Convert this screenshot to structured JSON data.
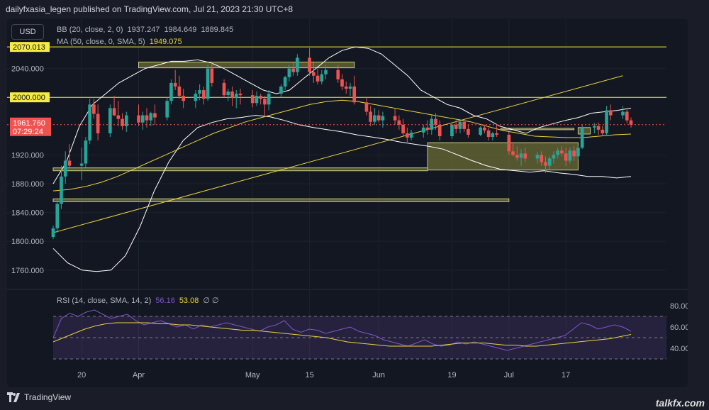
{
  "header": {
    "text": "dailyfxasia_legen published on TradingView.com, Jul 21, 2023 21:30 UTC+8"
  },
  "currency": "USD",
  "legend": {
    "bb": {
      "label": "BB (20, close, 2, 0)",
      "basis": "1937.247",
      "upper": "1984.649",
      "lower": "1889.845"
    },
    "ma": {
      "label": "MA (50, close, 0, SMA, 5)",
      "value": "1949.075"
    },
    "rsi": {
      "label": "RSI (14, close, SMA, 14, 2)",
      "value": "56.16",
      "sma": "53.08",
      "extra": "∅ ∅"
    }
  },
  "price_tag": {
    "price": "1961.760",
    "countdown": "07:29:24"
  },
  "footer": {
    "brand": "TradingView"
  },
  "watermark": "talkfx.com",
  "colors": {
    "up": "#26a69a",
    "down": "#ef5350",
    "bb": "#ffffff",
    "ma": "#e6d343",
    "rsi": "#7e57c2",
    "rsi_ma": "#e6d343",
    "level": "#f5eb42"
  },
  "chart_data": {
    "type": "candlestick",
    "instrument": "XAUUSD",
    "price_axis": {
      "ticks": [
        1760,
        1800,
        1840,
        1880,
        1920,
        2040
      ],
      "min": 1745,
      "max": 2080
    },
    "x_ticks": [
      "20",
      "Apr",
      "May",
      "15",
      "Jun",
      "19",
      "Jul",
      "17"
    ],
    "x_tick_dates": [
      "2023-03-20",
      "2023-04-03",
      "2023-05-01",
      "2023-05-15",
      "2023-06-01",
      "2023-06-19",
      "2023-07-03",
      "2023-07-17"
    ],
    "horizontal_levels": [
      {
        "price": 2070.013,
        "label": "2070.013"
      },
      {
        "price": 2000.0,
        "label": "2000.000"
      }
    ],
    "zones": [
      {
        "start": "2023-04-03",
        "end": "2023-05-26",
        "low": 2041,
        "high": 2049
      },
      {
        "start": "2023-03-13",
        "end": "2023-06-13",
        "low": 1898,
        "high": 1902
      },
      {
        "start": "2023-03-13",
        "end": "2023-07-03",
        "low": 1855,
        "high": 1859
      },
      {
        "start": "2023-06-13",
        "end": "2023-07-20",
        "low": 1899,
        "high": 1937
      },
      {
        "start": "2023-07-20",
        "end": "2023-07-23",
        "low": 1949,
        "high": 1958
      },
      {
        "start": "2023-07-01",
        "end": "2023-07-19",
        "low": 1955,
        "high": 1957
      }
    ],
    "trendline": {
      "start": {
        "date": "2023-03-13",
        "price": 1812
      },
      "end": {
        "date": "2023-07-24",
        "price": 2030
      }
    },
    "candles": [
      {
        "date": "2023-03-13",
        "o": 1806,
        "h": 1822,
        "l": 1803,
        "c": 1818
      },
      {
        "date": "2023-03-14",
        "o": 1818,
        "h": 1860,
        "l": 1812,
        "c": 1852
      },
      {
        "date": "2023-03-15",
        "o": 1852,
        "h": 1905,
        "l": 1845,
        "c": 1890
      },
      {
        "date": "2023-03-16",
        "o": 1890,
        "h": 1925,
        "l": 1880,
        "c": 1912
      },
      {
        "date": "2023-03-17",
        "o": 1912,
        "h": 1935,
        "l": 1902,
        "c": 1905
      },
      {
        "date": "2023-03-20",
        "o": 1905,
        "h": 1930,
        "l": 1885,
        "c": 1908
      },
      {
        "date": "2023-03-21",
        "o": 1908,
        "h": 1945,
        "l": 1902,
        "c": 1940
      },
      {
        "date": "2023-03-22",
        "o": 1940,
        "h": 1998,
        "l": 1935,
        "c": 1990
      },
      {
        "date": "2023-03-23",
        "o": 1990,
        "h": 1998,
        "l": 1970,
        "c": 1977
      },
      {
        "date": "2023-03-24",
        "o": 1977,
        "h": 1990,
        "l": 1940,
        "c": 1950
      },
      {
        "date": "2023-03-27",
        "o": 1950,
        "h": 1990,
        "l": 1945,
        "c": 1985
      },
      {
        "date": "2023-03-28",
        "o": 1985,
        "h": 2002,
        "l": 1974,
        "c": 1975
      },
      {
        "date": "2023-03-29",
        "o": 1975,
        "h": 1995,
        "l": 1960,
        "c": 1970
      },
      {
        "date": "2023-03-30",
        "o": 1970,
        "h": 1978,
        "l": 1955,
        "c": 1960
      },
      {
        "date": "2023-03-31",
        "o": 1960,
        "h": 1980,
        "l": 1952,
        "c": 1975
      },
      {
        "date": "2023-04-03",
        "o": 1975,
        "h": 1990,
        "l": 1960,
        "c": 1965
      },
      {
        "date": "2023-04-04",
        "o": 1965,
        "h": 1980,
        "l": 1955,
        "c": 1975
      },
      {
        "date": "2023-04-05",
        "o": 1975,
        "h": 1985,
        "l": 1958,
        "c": 1968
      },
      {
        "date": "2023-04-06",
        "o": 1968,
        "h": 1980,
        "l": 1960,
        "c": 1978
      },
      {
        "date": "2023-04-07",
        "o": 1978,
        "h": 1990,
        "l": 1962,
        "c": 1972
      },
      {
        "date": "2023-04-10",
        "o": 1972,
        "h": 2000,
        "l": 1968,
        "c": 1995
      },
      {
        "date": "2023-04-11",
        "o": 1995,
        "h": 2025,
        "l": 1990,
        "c": 2020
      },
      {
        "date": "2023-04-12",
        "o": 2020,
        "h": 2038,
        "l": 2010,
        "c": 2015
      },
      {
        "date": "2023-04-13",
        "o": 2015,
        "h": 2030,
        "l": 1998,
        "c": 2002
      },
      {
        "date": "2023-04-14",
        "o": 2002,
        "h": 2012,
        "l": 1985,
        "c": 1995
      },
      {
        "date": "2023-04-17",
        "o": 1995,
        "h": 2010,
        "l": 1985,
        "c": 2005
      },
      {
        "date": "2023-04-18",
        "o": 2005,
        "h": 2018,
        "l": 1996,
        "c": 2010
      },
      {
        "date": "2023-04-19",
        "o": 2010,
        "h": 2015,
        "l": 1990,
        "c": 1998
      },
      {
        "date": "2023-04-20",
        "o": 1998,
        "h": 2045,
        "l": 1995,
        "c": 2040
      },
      {
        "date": "2023-04-21",
        "o": 2040,
        "h": 2048,
        "l": 2015,
        "c": 2020
      },
      {
        "date": "2023-04-24",
        "o": 2020,
        "h": 2025,
        "l": 2000,
        "c": 2003
      },
      {
        "date": "2023-04-25",
        "o": 2003,
        "h": 2012,
        "l": 1995,
        "c": 2008
      },
      {
        "date": "2023-04-26",
        "o": 2008,
        "h": 2015,
        "l": 1988,
        "c": 1999
      },
      {
        "date": "2023-04-27",
        "o": 1999,
        "h": 2010,
        "l": 1985,
        "c": 2005
      },
      {
        "date": "2023-04-28",
        "o": 2005,
        "h": 2012,
        "l": 1990,
        "c": 2003
      },
      {
        "date": "2023-05-01",
        "o": 2003,
        "h": 2010,
        "l": 1986,
        "c": 1992
      },
      {
        "date": "2023-05-02",
        "o": 1992,
        "h": 2008,
        "l": 1988,
        "c": 2002
      },
      {
        "date": "2023-05-03",
        "o": 2002,
        "h": 2005,
        "l": 1990,
        "c": 1998
      },
      {
        "date": "2023-05-04",
        "o": 1998,
        "h": 2002,
        "l": 1975,
        "c": 1990
      },
      {
        "date": "2023-05-05",
        "o": 1990,
        "h": 2010,
        "l": 1982,
        "c": 2005
      },
      {
        "date": "2023-05-08",
        "o": 2005,
        "h": 2018,
        "l": 2000,
        "c": 2015
      },
      {
        "date": "2023-05-09",
        "o": 2015,
        "h": 2030,
        "l": 2010,
        "c": 2028
      },
      {
        "date": "2023-05-10",
        "o": 2028,
        "h": 2045,
        "l": 2022,
        "c": 2040
      },
      {
        "date": "2023-05-11",
        "o": 2040,
        "h": 2048,
        "l": 2030,
        "c": 2035
      },
      {
        "date": "2023-05-12",
        "o": 2035,
        "h": 2060,
        "l": 2030,
        "c": 2055
      },
      {
        "date": "2023-05-15",
        "o": 2055,
        "h": 2068,
        "l": 2030,
        "c": 2035
      },
      {
        "date": "2023-05-16",
        "o": 2035,
        "h": 2050,
        "l": 2020,
        "c": 2030
      },
      {
        "date": "2023-05-17",
        "o": 2030,
        "h": 2040,
        "l": 2018,
        "c": 2022
      },
      {
        "date": "2023-05-18",
        "o": 2022,
        "h": 2038,
        "l": 2018,
        "c": 2032
      },
      {
        "date": "2023-05-19",
        "o": 2032,
        "h": 2045,
        "l": 2025,
        "c": 2038
      },
      {
        "date": "2023-05-22",
        "o": 2038,
        "h": 2045,
        "l": 2020,
        "c": 2025
      },
      {
        "date": "2023-05-23",
        "o": 2025,
        "h": 2032,
        "l": 2010,
        "c": 2015
      },
      {
        "date": "2023-05-24",
        "o": 2015,
        "h": 2022,
        "l": 2005,
        "c": 2012
      },
      {
        "date": "2023-05-25",
        "o": 2012,
        "h": 2020,
        "l": 2002,
        "c": 2015
      },
      {
        "date": "2023-05-26",
        "o": 2015,
        "h": 2030,
        "l": 1990,
        "c": 1993
      },
      {
        "date": "2023-05-29",
        "o": 1993,
        "h": 2000,
        "l": 1975,
        "c": 1980
      },
      {
        "date": "2023-05-30",
        "o": 1980,
        "h": 1988,
        "l": 1960,
        "c": 1966
      },
      {
        "date": "2023-05-31",
        "o": 1966,
        "h": 1985,
        "l": 1962,
        "c": 1975
      },
      {
        "date": "2023-06-01",
        "o": 1975,
        "h": 1982,
        "l": 1965,
        "c": 1968
      },
      {
        "date": "2023-06-02",
        "o": 1968,
        "h": 1980,
        "l": 1958,
        "c": 1974
      },
      {
        "date": "2023-06-05",
        "o": 1974,
        "h": 1985,
        "l": 1962,
        "c": 1968
      },
      {
        "date": "2023-06-06",
        "o": 1968,
        "h": 1975,
        "l": 1955,
        "c": 1962
      },
      {
        "date": "2023-06-07",
        "o": 1962,
        "h": 1970,
        "l": 1945,
        "c": 1950
      },
      {
        "date": "2023-06-08",
        "o": 1950,
        "h": 1958,
        "l": 1938,
        "c": 1944
      },
      {
        "date": "2023-06-09",
        "o": 1944,
        "h": 1955,
        "l": 1940,
        "c": 1951
      },
      {
        "date": "2023-06-12",
        "o": 1951,
        "h": 1962,
        "l": 1944,
        "c": 1958
      },
      {
        "date": "2023-06-13",
        "o": 1958,
        "h": 1968,
        "l": 1948,
        "c": 1955
      },
      {
        "date": "2023-06-14",
        "o": 1955,
        "h": 1975,
        "l": 1948,
        "c": 1970
      },
      {
        "date": "2023-06-15",
        "o": 1970,
        "h": 1978,
        "l": 1955,
        "c": 1962
      },
      {
        "date": "2023-06-16",
        "o": 1962,
        "h": 1968,
        "l": 1940,
        "c": 1946
      },
      {
        "date": "2023-06-19",
        "o": 1946,
        "h": 1965,
        "l": 1942,
        "c": 1962
      },
      {
        "date": "2023-06-20",
        "o": 1962,
        "h": 1968,
        "l": 1950,
        "c": 1956
      },
      {
        "date": "2023-06-21",
        "o": 1956,
        "h": 1970,
        "l": 1950,
        "c": 1966
      },
      {
        "date": "2023-06-22",
        "o": 1966,
        "h": 1968,
        "l": 1952,
        "c": 1956
      },
      {
        "date": "2023-06-23",
        "o": 1956,
        "h": 1962,
        "l": 1944,
        "c": 1948
      },
      {
        "date": "2023-06-26",
        "o": 1948,
        "h": 1960,
        "l": 1946,
        "c": 1958
      },
      {
        "date": "2023-06-27",
        "o": 1958,
        "h": 1962,
        "l": 1950,
        "c": 1954
      },
      {
        "date": "2023-06-28",
        "o": 1954,
        "h": 1958,
        "l": 1940,
        "c": 1945
      },
      {
        "date": "2023-06-29",
        "o": 1945,
        "h": 1952,
        "l": 1940,
        "c": 1950
      },
      {
        "date": "2023-06-30",
        "o": 1950,
        "h": 1962,
        "l": 1945,
        "c": 1948
      },
      {
        "date": "2023-07-03",
        "o": 1948,
        "h": 1952,
        "l": 1920,
        "c": 1925
      },
      {
        "date": "2023-07-04",
        "o": 1925,
        "h": 1936,
        "l": 1918,
        "c": 1920
      },
      {
        "date": "2023-07-05",
        "o": 1920,
        "h": 1932,
        "l": 1912,
        "c": 1916
      },
      {
        "date": "2023-07-06",
        "o": 1916,
        "h": 1928,
        "l": 1905,
        "c": 1922
      },
      {
        "date": "2023-07-07",
        "o": 1922,
        "h": 1930,
        "l": 1910,
        "c": 1915
      },
      {
        "date": "2023-07-10",
        "o": 1915,
        "h": 1924,
        "l": 1908,
        "c": 1920
      },
      {
        "date": "2023-07-11",
        "o": 1920,
        "h": 1925,
        "l": 1905,
        "c": 1910
      },
      {
        "date": "2023-07-12",
        "o": 1910,
        "h": 1918,
        "l": 1895,
        "c": 1905
      },
      {
        "date": "2023-07-13",
        "o": 1905,
        "h": 1918,
        "l": 1900,
        "c": 1915
      },
      {
        "date": "2023-07-14",
        "o": 1915,
        "h": 1925,
        "l": 1908,
        "c": 1920
      },
      {
        "date": "2023-07-15",
        "o": 1920,
        "h": 1930,
        "l": 1915,
        "c": 1926
      },
      {
        "date": "2023-07-16",
        "o": 1926,
        "h": 1932,
        "l": 1918,
        "c": 1922
      },
      {
        "date": "2023-07-17",
        "o": 1922,
        "h": 1930,
        "l": 1905,
        "c": 1912
      },
      {
        "date": "2023-07-18",
        "o": 1912,
        "h": 1930,
        "l": 1908,
        "c": 1926
      },
      {
        "date": "2023-07-19",
        "o": 1926,
        "h": 1932,
        "l": 1912,
        "c": 1918
      },
      {
        "date": "2023-07-20",
        "o": 1918,
        "h": 1932,
        "l": 1914,
        "c": 1930
      },
      {
        "date": "2023-07-21",
        "o": 1930,
        "h": 1962,
        "l": 1928,
        "c": 1958
      },
      {
        "date": "2023-07-24",
        "o": 1958,
        "h": 1964,
        "l": 1950,
        "c": 1960
      },
      {
        "date": "2023-07-25",
        "o": 1960,
        "h": 1965,
        "l": 1948,
        "c": 1955
      },
      {
        "date": "2023-07-26",
        "o": 1955,
        "h": 1960,
        "l": 1946,
        "c": 1950
      },
      {
        "date": "2023-07-27",
        "o": 1950,
        "h": 1988,
        "l": 1948,
        "c": 1982
      },
      {
        "date": "2023-07-28",
        "o": 1982,
        "h": 1990,
        "l": 1968,
        "c": 1975
      },
      {
        "date": "2023-07-31",
        "o": 1975,
        "h": 1988,
        "l": 1970,
        "c": 1980
      },
      {
        "date": "2023-08-01",
        "o": 1980,
        "h": 1985,
        "l": 1964,
        "c": 1968
      },
      {
        "date": "2023-08-02",
        "o": 1968,
        "h": 1972,
        "l": 1958,
        "c": 1962
      }
    ],
    "bb_upper": [
      1880,
      1910,
      1960,
      1990,
      2005,
      2020,
      2030,
      2040,
      2045,
      2050,
      2050,
      2052,
      2048,
      2040,
      2030,
      2020,
      2010,
      2005,
      2010,
      2025,
      2040,
      2055,
      2065,
      2070,
      2068,
      2060,
      2045,
      2030,
      2010,
      2000,
      1990,
      1985,
      1975,
      1970,
      1960,
      1955,
      1950,
      1958,
      1963,
      1968,
      1972,
      1978,
      1980,
      1982,
      1985
    ],
    "bb_lower": [
      1790,
      1770,
      1760,
      1758,
      1760,
      1780,
      1820,
      1870,
      1910,
      1940,
      1958,
      1965,
      1970,
      1972,
      1975,
      1973,
      1968,
      1962,
      1958,
      1955,
      1952,
      1948,
      1945,
      1942,
      1938,
      1935,
      1932,
      1928,
      1920,
      1912,
      1905,
      1900,
      1898,
      1896,
      1898,
      1895,
      1893,
      1890,
      1890,
      1888,
      1890
    ],
    "ma50": [
      1870,
      1872,
      1876,
      1882,
      1890,
      1900,
      1910,
      1920,
      1930,
      1940,
      1950,
      1958,
      1966,
      1972,
      1978,
      1984,
      1990,
      1994,
      1996,
      1994,
      1990,
      1986,
      1982,
      1978,
      1974,
      1970,
      1966,
      1960,
      1954,
      1950,
      1946,
      1945,
      1944,
      1944,
      1946,
      1948,
      1949
    ],
    "rsi": {
      "axis": {
        "ticks": [
          40,
          60,
          80
        ],
        "min": 30,
        "max": 82
      },
      "bands": [
        30,
        50,
        70
      ],
      "values": [
        50,
        68,
        73,
        70,
        74,
        76,
        72,
        68,
        70,
        72,
        66,
        62,
        64,
        66,
        63,
        60,
        62,
        58,
        62,
        60,
        62,
        64,
        62,
        60,
        58,
        56,
        60,
        62,
        66,
        58,
        55,
        58,
        57,
        54,
        56,
        58,
        60,
        56,
        54,
        52,
        48,
        46,
        44,
        42,
        45,
        48,
        44,
        42,
        43,
        46,
        44,
        46,
        44,
        42,
        40,
        38,
        40,
        42,
        44,
        46,
        48,
        50,
        52,
        58,
        64,
        62,
        58,
        60,
        62,
        60,
        56
      ],
      "sma": [
        46,
        50,
        54,
        58,
        61,
        63,
        64,
        64,
        64,
        64,
        63,
        63,
        62,
        62,
        61,
        60,
        59,
        58,
        57,
        57,
        56,
        55,
        54,
        53,
        52,
        51,
        50,
        48,
        46,
        45,
        44,
        43,
        42,
        42,
        42,
        42,
        42,
        43,
        44,
        45,
        45,
        45,
        44,
        43,
        43,
        42,
        42,
        43,
        44,
        45,
        46,
        47,
        48,
        49,
        51,
        53
      ]
    }
  }
}
